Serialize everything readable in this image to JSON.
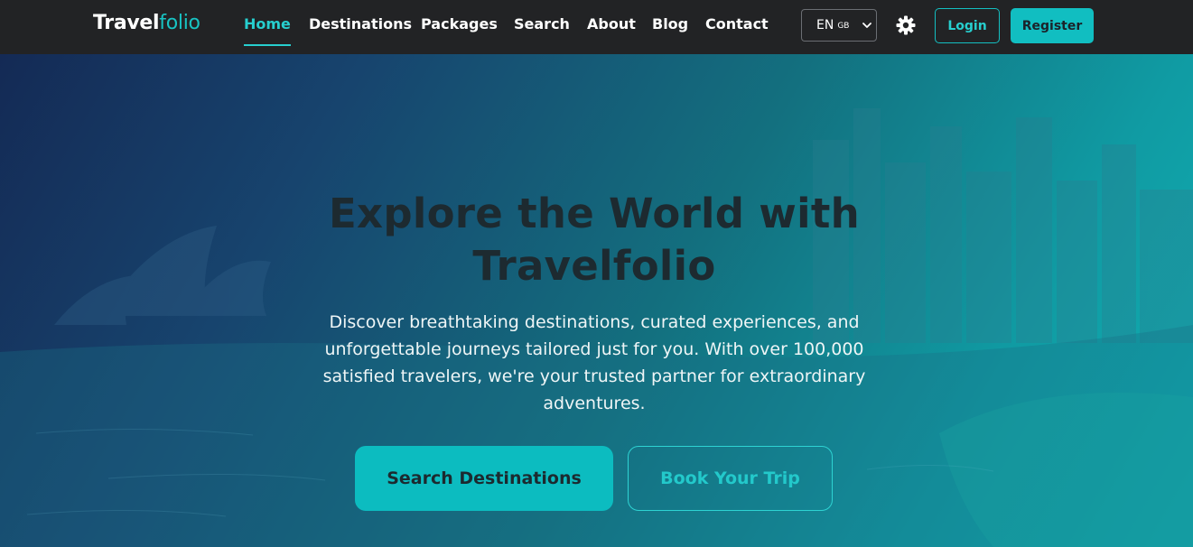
{
  "brand": {
    "part1": "Travel",
    "part2": "folio"
  },
  "nav": {
    "home": "Home",
    "destinations": "Destinations",
    "packages": "Packages",
    "search": "Search",
    "about": "About",
    "blog": "Blog",
    "contact": "Contact"
  },
  "language": {
    "code": "EN",
    "region": "GB"
  },
  "auth": {
    "login": "Login",
    "register": "Register"
  },
  "hero": {
    "title": "Explore the World with Travelfolio",
    "description": "Discover breathtaking destinations, curated experiences, and unforgettable journeys tailored just for you. With over 100,000 satisfied travelers, we're your trusted partner for extraordinary adventures.",
    "primary_cta": "Search Destinations",
    "secondary_cta": "Book Your Trip"
  },
  "colors": {
    "accent": "#11bec1",
    "navbar_bg": "#222325"
  },
  "icons": [
    "settings-gear-icon",
    "chevron-down-icon"
  ]
}
